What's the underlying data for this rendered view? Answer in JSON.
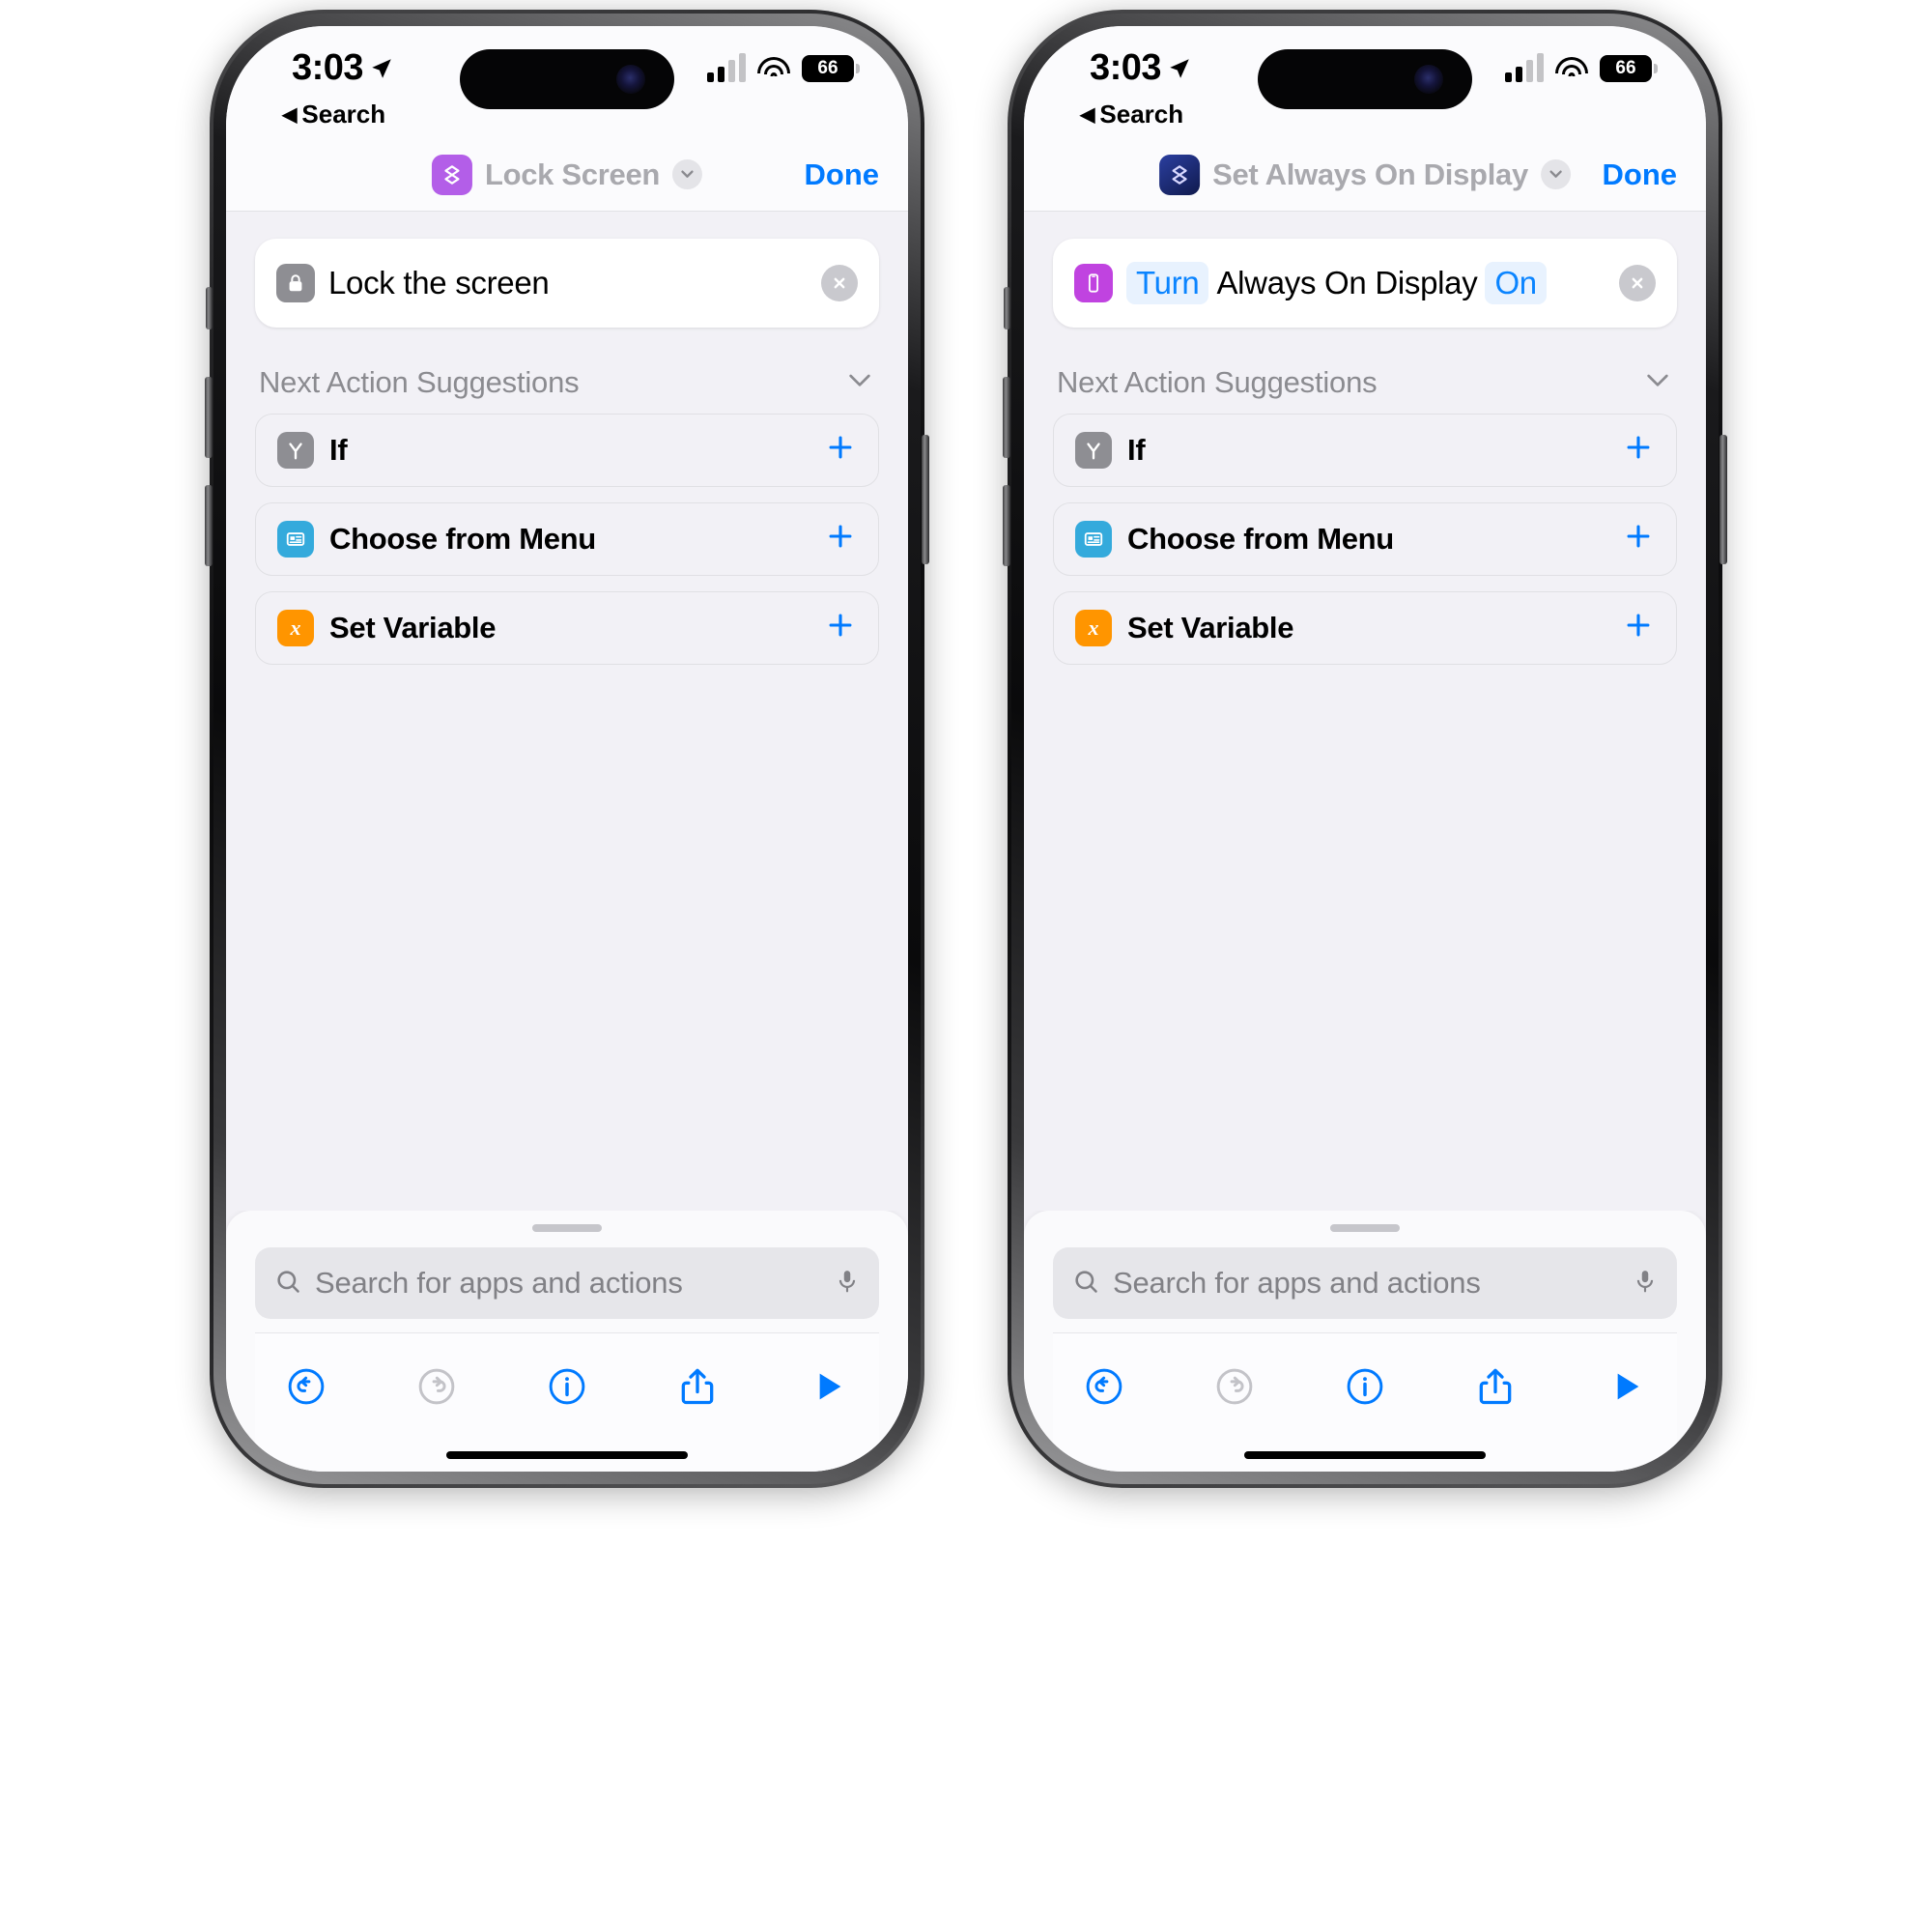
{
  "phones": [
    {
      "id": "left",
      "status_bar": {
        "time": "3:03",
        "location_icon": "location-arrow-icon",
        "back_label": "Search",
        "signal_icon": "cellular-signal-icon",
        "wifi_icon": "wifi-icon",
        "battery_level": "66"
      },
      "nav": {
        "workflow_icon": "shortcut-glyph-icon",
        "workflow_icon_color": "#b35ee8",
        "title": "Lock Screen",
        "chevron_icon": "chevron-down-icon",
        "done_label": "Done"
      },
      "action": {
        "icon": "lock-icon",
        "icon_color": "#8e8e93",
        "text": "Lock the screen",
        "tokens": [],
        "clear_icon": "clear-circle-icon"
      },
      "suggestions": {
        "header": "Next Action Suggestions",
        "collapse_icon": "chevron-down-icon",
        "rows": [
          {
            "icon": "if-branch-icon",
            "icon_color": "#8e8e93",
            "label": "If",
            "add_icon": "plus-icon"
          },
          {
            "icon": "menu-card-icon",
            "icon_color": "#34aadc",
            "label": "Choose from Menu",
            "add_icon": "plus-icon"
          },
          {
            "icon": "variable-x-icon",
            "icon_color": "#ff9500",
            "label": "Set Variable",
            "add_icon": "plus-icon"
          }
        ]
      },
      "sheet": {
        "search_placeholder": "Search for apps and actions",
        "search_icon": "search-icon",
        "mic_icon": "microphone-icon"
      },
      "toolbar": [
        {
          "icon": "undo-icon",
          "state": "enabled"
        },
        {
          "icon": "redo-icon",
          "state": "disabled"
        },
        {
          "icon": "info-icon",
          "state": "enabled"
        },
        {
          "icon": "share-icon",
          "state": "enabled"
        },
        {
          "icon": "play-icon",
          "state": "enabled"
        }
      ]
    },
    {
      "id": "right",
      "status_bar": {
        "time": "3:03",
        "location_icon": "location-arrow-icon",
        "back_label": "Search",
        "signal_icon": "cellular-signal-icon",
        "wifi_icon": "wifi-icon",
        "battery_level": "66"
      },
      "nav": {
        "workflow_icon": "shortcut-glyph-icon",
        "workflow_icon_color": "#1c2b6b",
        "title": "Set Always On Display",
        "chevron_icon": "chevron-down-icon",
        "done_label": "Done"
      },
      "action": {
        "icon": "iphone-icon",
        "icon_color": "#c043e0",
        "text_parts": [
          {
            "type": "token",
            "text": "Turn"
          },
          {
            "type": "plain",
            "text": "Always On Display"
          },
          {
            "type": "token",
            "text": "On"
          }
        ],
        "clear_icon": "clear-circle-icon"
      },
      "suggestions": {
        "header": "Next Action Suggestions",
        "collapse_icon": "chevron-down-icon",
        "rows": [
          {
            "icon": "if-branch-icon",
            "icon_color": "#8e8e93",
            "label": "If",
            "add_icon": "plus-icon"
          },
          {
            "icon": "menu-card-icon",
            "icon_color": "#34aadc",
            "label": "Choose from Menu",
            "add_icon": "plus-icon"
          },
          {
            "icon": "variable-x-icon",
            "icon_color": "#ff9500",
            "label": "Set Variable",
            "add_icon": "plus-icon"
          }
        ]
      },
      "sheet": {
        "search_placeholder": "Search for apps and actions",
        "search_icon": "search-icon",
        "mic_icon": "microphone-icon"
      },
      "toolbar": [
        {
          "icon": "undo-icon",
          "state": "enabled"
        },
        {
          "icon": "redo-icon",
          "state": "disabled"
        },
        {
          "icon": "info-icon",
          "state": "enabled"
        },
        {
          "icon": "share-icon",
          "state": "enabled"
        },
        {
          "icon": "play-icon",
          "state": "enabled"
        }
      ]
    }
  ],
  "colors": {
    "accent_blue": "#007aff",
    "token_blue": "#0a84ff",
    "token_bg": "#e8f2fe",
    "disabled_gray": "#c3c3c8",
    "screen_bg": "#f2f1f6"
  }
}
